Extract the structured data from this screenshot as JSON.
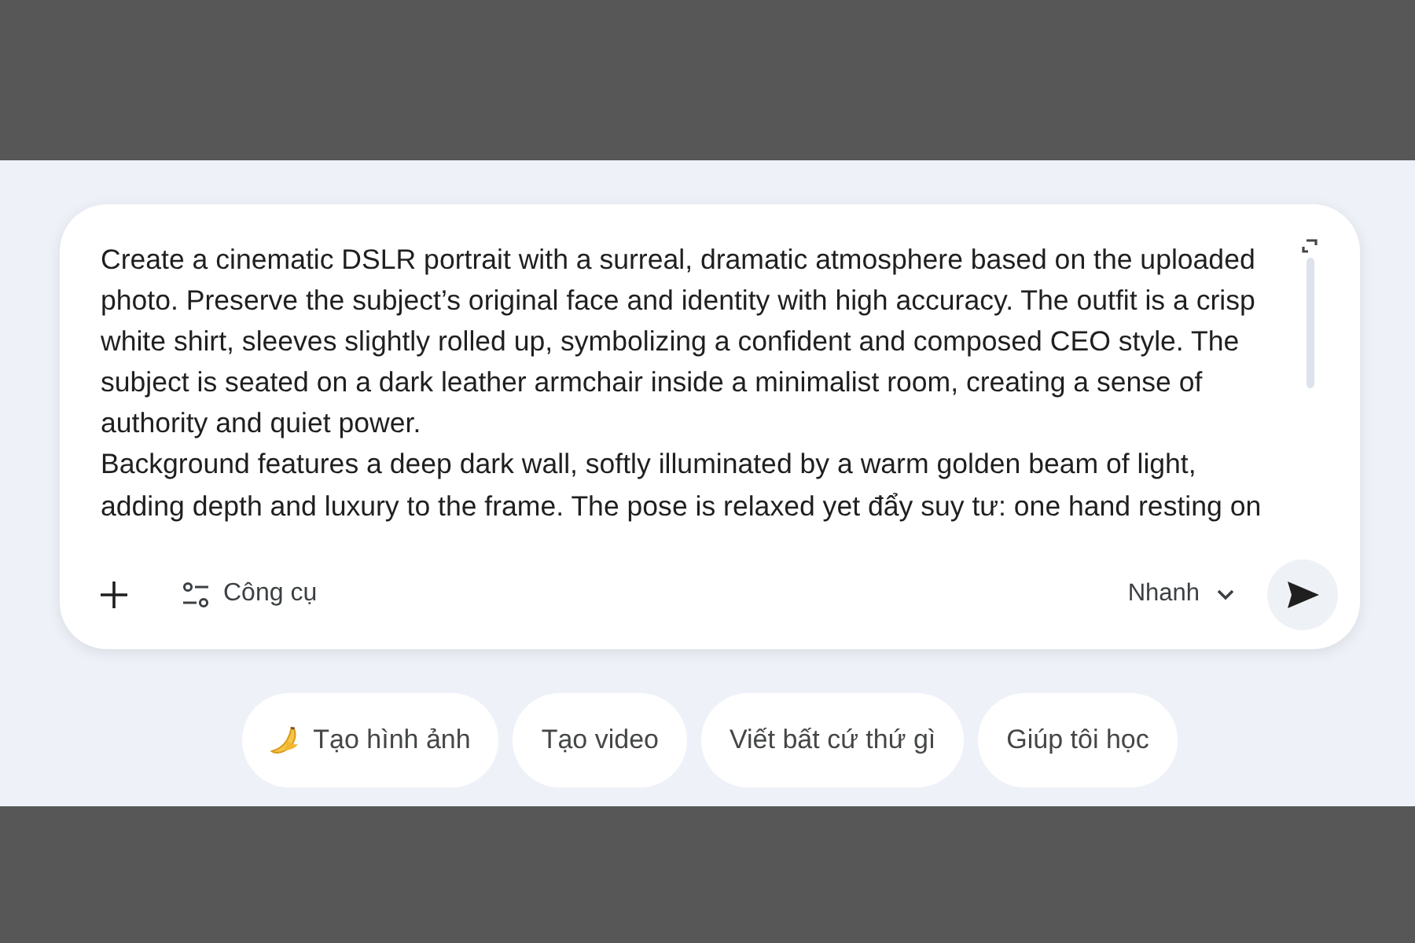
{
  "prompt": {
    "lines": [
      "Create a cinematic DSLR portrait with a surreal, dramatic atmosphere based on the uploaded",
      "photo. Preserve the subject’s original face and identity with high accuracy. The outfit is a crisp",
      "white shirt, sleeves slightly rolled up, symbolizing a confident and composed CEO style. The",
      "subject is seated on a dark leather armchair inside a minimalist room, creating a sense of",
      "authority and quiet power.",
      "Background features a deep dark wall, softly illuminated by a warm golden beam of light,",
      "adding depth and luxury to the frame. The pose is relaxed yet đẩy suy tư: one hand resting on"
    ]
  },
  "toolbar": {
    "tools_button": {
      "label": "Công cụ"
    },
    "mode_dropdown": {
      "label": "Nhanh"
    }
  },
  "suggestions": [
    {
      "label": "Tạo hình ảnh",
      "kind": "emoji"
    },
    {
      "label": "Tạo video",
      "kind": "plain"
    },
    {
      "label": "Viết bất cứ thứ gì",
      "kind": "plain"
    },
    {
      "label": "Giúp tôi học",
      "kind": "plain"
    }
  ]
}
